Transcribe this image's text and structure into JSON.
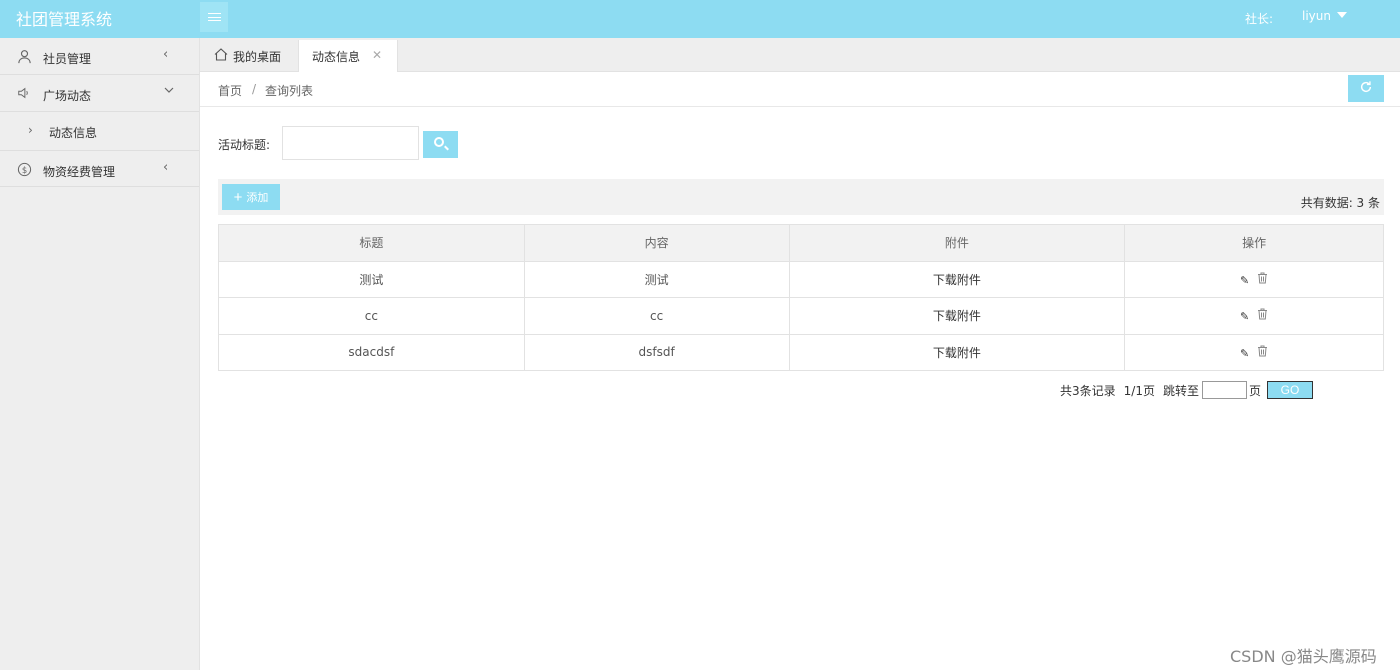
{
  "header": {
    "app_title": "社团管理系统",
    "role_label": "社长:",
    "username": "liyun"
  },
  "sidebar": {
    "items": [
      {
        "label": "社员管理",
        "icon": "user-icon"
      },
      {
        "label": "广场动态",
        "icon": "speaker-icon"
      },
      {
        "label": "动态信息"
      },
      {
        "label": "物资经费管理",
        "icon": "dollar-circle-icon"
      }
    ]
  },
  "tabs": [
    {
      "label": "我的桌面"
    },
    {
      "label": "动态信息"
    }
  ],
  "breadcrumb": {
    "home": "首页",
    "separator": "/",
    "current": "查询列表"
  },
  "search": {
    "label": "活动标题:",
    "value": ""
  },
  "toolbar": {
    "add_label": "添加",
    "total_text": "共有数据: 3 条"
  },
  "table": {
    "headers": [
      "标题",
      "内容",
      "附件",
      "操作"
    ],
    "rows": [
      {
        "title": "测试",
        "content": "测试",
        "attachment": "下载附件"
      },
      {
        "title": "cc",
        "content": "cc",
        "attachment": "下载附件"
      },
      {
        "title": "sdacdsf",
        "content": "dsfsdf",
        "attachment": "下载附件"
      }
    ]
  },
  "pagination": {
    "records_text": "共3条记录",
    "pages_text": "1/1页",
    "jump_label": "跳转至",
    "page_unit": "页",
    "go_label": "GO",
    "page_value": ""
  },
  "watermark": "CSDN @猫头鹰源码"
}
